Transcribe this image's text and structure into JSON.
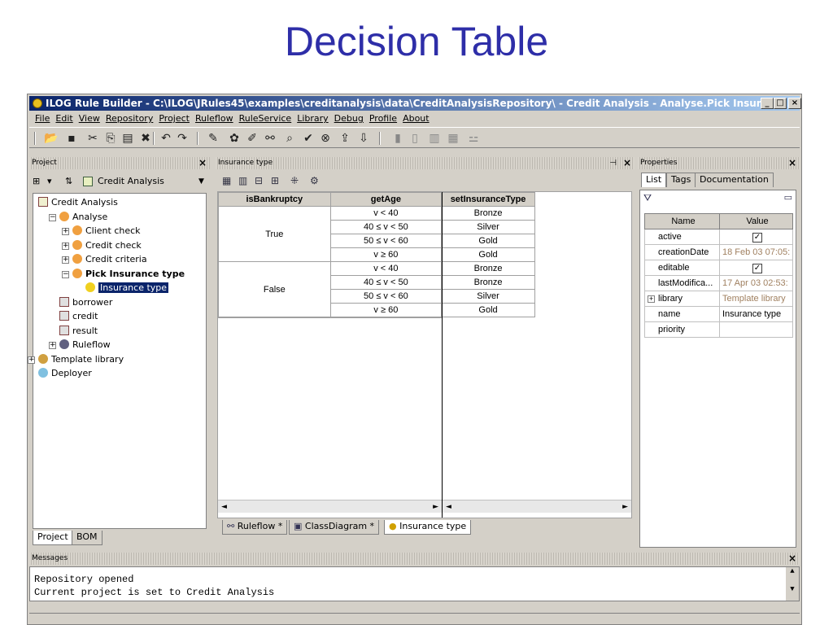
{
  "slide_title": "Decision Table",
  "window": {
    "title": "ILOG Rule Builder - C:\\ILOG\\JRules45\\examples\\creditanalysis\\data\\CreditAnalysisRepository\\ - Credit Analysis - Analyse.Pick Insurance...",
    "min": "_",
    "max": "□",
    "close": "×"
  },
  "menu": [
    "File",
    "Edit",
    "View",
    "Repository",
    "Project",
    "Ruleflow",
    "RuleService",
    "Library",
    "Debug",
    "Profile",
    "About"
  ],
  "toolbar_icons": [
    "open-icon",
    "save-icon",
    "cut-icon",
    "copy-icon",
    "paste-icon",
    "delete-icon",
    "undo-icon",
    "redo-icon",
    "new-rule-icon",
    "new-ruleset-icon",
    "new-package-icon",
    "hierarchy-icon",
    "find-icon",
    "check-icon",
    "error-icon",
    "export-icon",
    "import-icon",
    "bookmark-icon",
    "doc-icon",
    "page-icon",
    "table-icon",
    "tree-icon"
  ],
  "project_panel": {
    "title": "Project",
    "close": "×",
    "combo": "Credit Analysis",
    "tree": [
      {
        "label": "Credit Analysis",
        "depth": 0,
        "icon": "project-icon"
      },
      {
        "label": "Analyse",
        "depth": 1,
        "icon": "package-icon",
        "pm": "−"
      },
      {
        "label": "Client check",
        "depth": 2,
        "icon": "package-icon",
        "pm": "+"
      },
      {
        "label": "Credit check",
        "depth": 2,
        "icon": "package-icon",
        "pm": "+"
      },
      {
        "label": "Credit criteria",
        "depth": 2,
        "icon": "package-icon",
        "pm": "+"
      },
      {
        "label": "Pick Insurance type",
        "depth": 2,
        "icon": "package-icon",
        "pm": "−",
        "bold": true
      },
      {
        "label": "Insurance type",
        "depth": 3,
        "icon": "rule-icon",
        "selected": true
      },
      {
        "label": "borrower",
        "depth": 1,
        "icon": "variable-icon"
      },
      {
        "label": "credit",
        "depth": 1,
        "icon": "variable-icon"
      },
      {
        "label": "result",
        "depth": 1,
        "icon": "variable-icon"
      },
      {
        "label": "Ruleflow",
        "depth": 1,
        "icon": "ruleflow-icon",
        "pm": "+"
      },
      {
        "label": "Template library",
        "depth": 0,
        "icon": "library-icon",
        "pm": "+"
      },
      {
        "label": "Deployer",
        "depth": 0,
        "icon": "deployer-icon"
      }
    ],
    "tabs": [
      "Project",
      "BOM"
    ]
  },
  "editor": {
    "title": "Insurance type",
    "headers": [
      "isBankruptcy",
      "getAge",
      "setInsuranceType"
    ],
    "groups": [
      {
        "condition": "True",
        "rows": [
          [
            "v < 40",
            "Bronze"
          ],
          [
            "40 ≤ v < 50",
            "Silver"
          ],
          [
            "50 ≤ v < 60",
            "Gold"
          ],
          [
            "v ≥ 60",
            "Gold"
          ]
        ]
      },
      {
        "condition": "False",
        "rows": [
          [
            "v < 40",
            "Bronze"
          ],
          [
            "40 ≤ v < 50",
            "Bronze"
          ],
          [
            "50 ≤ v < 60",
            "Silver"
          ],
          [
            "v ≥ 60",
            "Gold"
          ]
        ]
      }
    ],
    "tabs": [
      "Ruleflow *",
      "ClassDiagram *",
      "Insurance type"
    ]
  },
  "properties": {
    "title": "Properties",
    "close": "×",
    "tabs": [
      "List",
      "Tags",
      "Documentation"
    ],
    "col_name": "Name",
    "col_value": "Value",
    "rows": [
      {
        "name": "active",
        "value": "",
        "check": true
      },
      {
        "name": "creationDate",
        "value": "18 Feb 03 07:05:",
        "grey": true
      },
      {
        "name": "editable",
        "value": "",
        "check": true
      },
      {
        "name": "lastModifica...",
        "value": "17 Apr 03 02:53:",
        "grey": true
      },
      {
        "name": "library",
        "value": "Template library",
        "grey": true,
        "pm": "+"
      },
      {
        "name": "name",
        "value": "Insurance type"
      },
      {
        "name": "priority",
        "value": ""
      }
    ]
  },
  "messages": {
    "title": "Messages",
    "close": "×",
    "lines": [
      "Repository opened",
      "Current project is set to Credit Analysis"
    ]
  }
}
